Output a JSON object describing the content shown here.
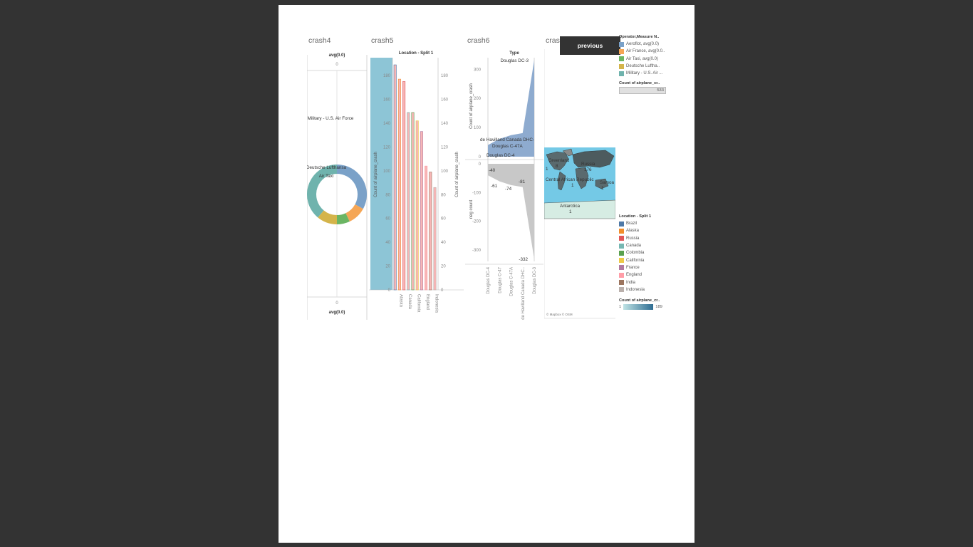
{
  "panels": {
    "crash4_title": "crash4",
    "crash5_title": "crash5",
    "crash6_title": "crash6",
    "crash7_title": "cras"
  },
  "previous_button": "previous",
  "colors": {
    "aeroflot": "#7aa1c8",
    "air_france": "#f5a655",
    "air_taxi": "#6bb563",
    "deutsche": "#d4b44a",
    "military": "#6fb3ad",
    "brazil": "#4e79a7",
    "alaska": "#f28e2b",
    "russia": "#e15759",
    "canada": "#76b7b2",
    "colombia": "#59a14f",
    "california": "#edc948",
    "france": "#b07aa1",
    "england": "#ff9da7",
    "india": "#9c755f",
    "indonesia": "#bab0ac",
    "highlight_band": "#8dc5d6",
    "map_ocean": "#74c9e6"
  },
  "legend_operator": {
    "title": "Operator,Measure N..",
    "items": [
      "Aeroflot, avg(0.0)",
      "Air France, avg(0.0..",
      "Air Taxi, avg(0.0)",
      "Deutsche Luftha..",
      "Military - U.S. Air ..."
    ]
  },
  "legend_count1": {
    "title": "Count of airplane_cr..",
    "value": "533"
  },
  "legend_location": {
    "title": "Location - Split 1",
    "items": [
      "Brazil",
      "Alaska",
      "Russia",
      "Canada",
      "Colombia",
      "California",
      "France",
      "England",
      "India",
      "Indonesia"
    ]
  },
  "legend_count2": {
    "title": "Count of airplane_cr..",
    "min": "1",
    "max": "189"
  },
  "map_attribution": "© Mapbox © OSM",
  "map_labels": {
    "greenland": "Greenland",
    "greenland_val": "8",
    "russia": "Russia",
    "russia_val": "176",
    "central_africa": "Central African Republic",
    "central_africa_val": "1",
    "samoa": "Samoa",
    "samoa_val": "1",
    "antarctica": "Antarctica",
    "antarctica_val": "1",
    "small_val": "1"
  },
  "chart_data": [
    {
      "type": "pie",
      "title": "",
      "top_axis_label": "avg(0.0)",
      "top_axis_tick": "0",
      "bottom_axis_label": "avg(0.0)",
      "bottom_axis_tick": "0",
      "slices": [
        {
          "label": "Military - U.S. Air Force",
          "value": 33
        },
        {
          "label": "",
          "value": 10
        },
        {
          "label": "Air Taxi",
          "value": 7
        },
        {
          "label": "Deutsche Lufthansa",
          "value": 11
        },
        {
          "label": "",
          "value": 39
        }
      ]
    },
    {
      "type": "bar",
      "title": "Location - Split 1",
      "ylabel": "Count of airplane_crash",
      "ylabel_right": "Count of airplane_crash",
      "ylim": [
        0,
        195
      ],
      "yticks": [
        "0",
        "20",
        "40",
        "60",
        "80",
        "100",
        "120",
        "140",
        "160",
        "180"
      ],
      "categories": [
        "Brazil",
        "Alaska",
        "Russia",
        "Canada",
        "Colombia",
        "California",
        "France",
        "England",
        "India",
        "Indonesia"
      ],
      "category_labels_shown": [
        "",
        "Alaska",
        "",
        "Canada",
        "",
        "California",
        "",
        "England",
        "",
        "Indonesia"
      ],
      "values": [
        189,
        177,
        175,
        149,
        149,
        142,
        133,
        104,
        99,
        86
      ]
    },
    {
      "type": "area",
      "title": "Type",
      "ylabel_top": "Count of airplane_crash",
      "ylabel_bottom": "neg count",
      "categories": [
        "Douglas DC-4",
        "Douglas C-47",
        "Douglas C-47A",
        "de Havilland Canada DHC..",
        "Douglas DC-3"
      ],
      "positive_values": [
        40,
        61,
        74,
        81,
        332
      ],
      "negative_values": [
        -40,
        -61,
        -74,
        -81,
        -332
      ],
      "top_ticks": [
        "0",
        "100",
        "200",
        "300"
      ],
      "bottom_ticks": [
        "0",
        "-100",
        "-200",
        "-300"
      ],
      "annotations": {
        "dc3": "Douglas DC-3",
        "dhc": "de Havilland Canada DHC-",
        "c47a": "Douglas C-47A",
        "dc4": "Douglas DC-4",
        "n40": "-40",
        "n61": "-61",
        "n74": "-74",
        "n81": "-81",
        "n332": "-332"
      }
    }
  ]
}
